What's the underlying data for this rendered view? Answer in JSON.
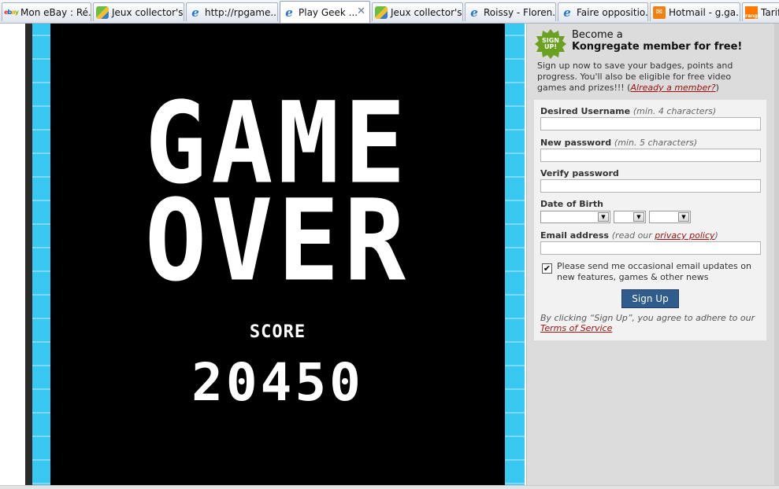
{
  "tabs": [
    {
      "label": "Mon eBay : Ré...",
      "icon": "ebay-icon"
    },
    {
      "label": "Jeux collector's...",
      "icon": "game-site-icon"
    },
    {
      "label": "http://rpgame....",
      "icon": "ie-icon"
    },
    {
      "label": "Play Geek ...",
      "icon": "ie-icon",
      "active": true
    },
    {
      "label": "Jeux collector's...",
      "icon": "game-site-icon"
    },
    {
      "label": "Roissy - Floren...",
      "icon": "ie-icon"
    },
    {
      "label": "Faire oppositio...",
      "icon": "ie-icon"
    },
    {
      "label": "Hotmail - g.ga...",
      "icon": "hotmail-icon"
    },
    {
      "label": "Tarifs",
      "icon": "orange-icon"
    }
  ],
  "tab_close_glyph": "✕",
  "game": {
    "line1": "GAME",
    "line2": "OVER",
    "score_label": "SCORE",
    "score_value": "20450"
  },
  "signup": {
    "badge_line1": "SIGN",
    "badge_line2": "UP!",
    "become": "Become a",
    "kong": "Kongregate member for free!",
    "intro": "Sign up now to save your badges, points and progress. You'll also be eligible for free video games and prizes!!! (",
    "already_member": "Already a member?",
    "intro_close": ")",
    "username_label": "Desired Username",
    "username_hint": "(min. 4 characters)",
    "password_label": "New password",
    "password_hint": "(min. 5 characters)",
    "verify_label": "Verify password",
    "dob_label": "Date of Birth",
    "email_label": "Email address",
    "email_hint_open": "(read our ",
    "privacy_link": "privacy policy",
    "email_hint_close": ")",
    "newsletter_text": "Please send me occasional email updates on new features, games & other news",
    "newsletter_checked": true,
    "submit_label": "Sign Up",
    "terms_text": "By clicking “Sign Up”, you agree to adhere to our ",
    "terms_link": "Terms of Service"
  },
  "colors": {
    "stripe": "#39c8f2",
    "button": "#2f5c8d",
    "link": "#a01010",
    "badge": "#6aa121"
  }
}
